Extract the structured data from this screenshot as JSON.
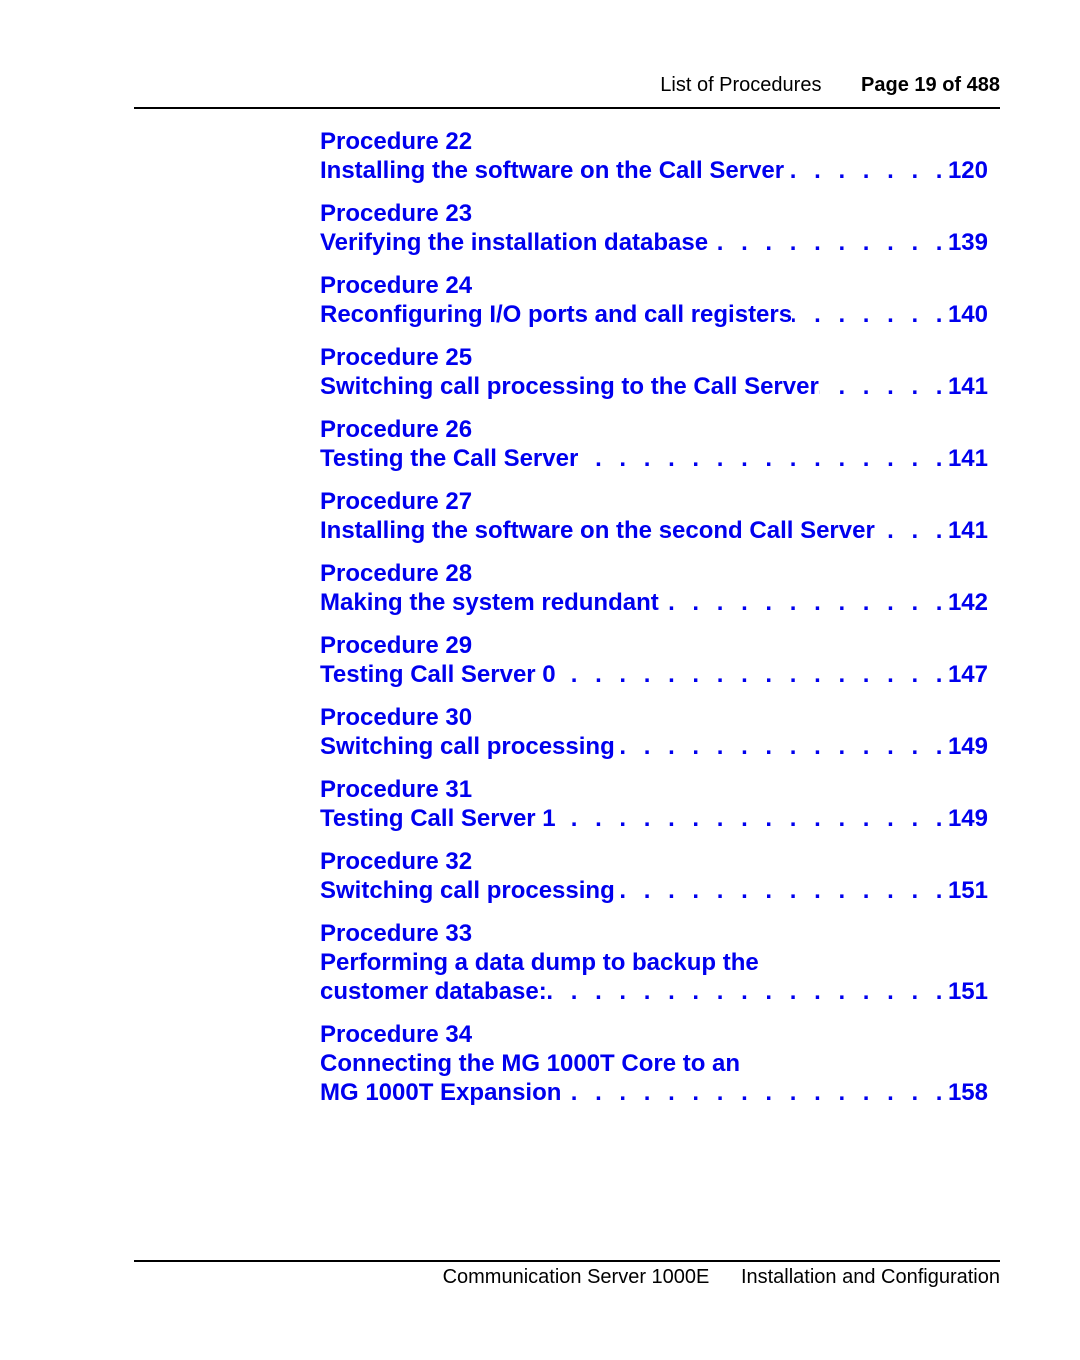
{
  "header": {
    "section": "List of Procedures",
    "page": "Page 19 of 488"
  },
  "entries": [
    {
      "proc": "Procedure 22",
      "lines": [
        "Installing the software on the Call Server"
      ],
      "page": "120"
    },
    {
      "proc": "Procedure 23",
      "lines": [
        "Verifying the installation database"
      ],
      "page": "139"
    },
    {
      "proc": "Procedure 24",
      "lines": [
        "Reconfiguring I/O ports and call registers"
      ],
      "page": "140"
    },
    {
      "proc": "Procedure 25",
      "lines": [
        "Switching call processing to the Call Server"
      ],
      "page": "141"
    },
    {
      "proc": "Procedure 26",
      "lines": [
        "Testing the Call Server"
      ],
      "page": "141"
    },
    {
      "proc": "Procedure 27",
      "lines": [
        "Installing the software on the second Call Server"
      ],
      "page": "141"
    },
    {
      "proc": "Procedure 28",
      "lines": [
        "Making the system redundant"
      ],
      "page": "142"
    },
    {
      "proc": "Procedure 29",
      "lines": [
        "Testing Call Server 0"
      ],
      "page": "147"
    },
    {
      "proc": "Procedure 30",
      "lines": [
        "Switching call processing"
      ],
      "page": "149"
    },
    {
      "proc": "Procedure 31",
      "lines": [
        "Testing Call Server 1"
      ],
      "page": "149"
    },
    {
      "proc": "Procedure 32",
      "lines": [
        "Switching call processing"
      ],
      "page": "151"
    },
    {
      "proc": "Procedure 33",
      "lines": [
        "Performing a data dump to backup the",
        "customer database:"
      ],
      "page": "151"
    },
    {
      "proc": "Procedure 34",
      "lines": [
        "Connecting the MG 1000T Core to an",
        "MG 1000T Expansion"
      ],
      "page": "158"
    }
  ],
  "footer": {
    "product": "Communication Server 1000E",
    "doc": "Installation and Configuration"
  },
  "colors": {
    "link": "#0000ee",
    "text": "#000000"
  }
}
